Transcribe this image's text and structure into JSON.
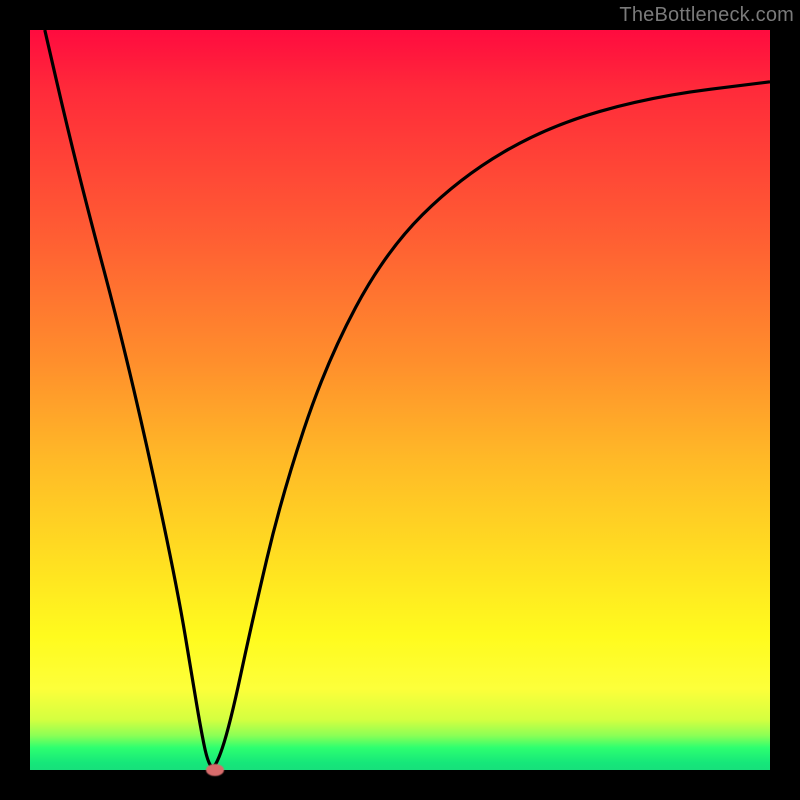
{
  "watermark": "TheBottleneck.com",
  "chart_data": {
    "type": "line",
    "title": "",
    "xlabel": "",
    "ylabel": "",
    "xlim": [
      0,
      100
    ],
    "ylim": [
      0,
      100
    ],
    "grid": false,
    "note": "Axes are unlabeled; values are normalized 0–100. Curve read from plotted line (approx).",
    "series": [
      {
        "name": "curve",
        "x": [
          2,
          5,
          8,
          12,
          16,
          20,
          22,
          23,
          24,
          25,
          27,
          30,
          34,
          40,
          48,
          58,
          70,
          84,
          100
        ],
        "y": [
          100,
          87,
          75,
          60,
          43,
          24,
          12,
          6,
          1,
          0,
          6,
          20,
          37,
          55,
          70,
          80,
          87,
          91,
          93
        ]
      }
    ],
    "marker": {
      "name": "minimum-point",
      "x": 25,
      "y": 0,
      "color": "#d86b6b"
    },
    "background_gradient": {
      "direction": "vertical",
      "stops": [
        {
          "pos": 0.0,
          "color": "#ff0b3f"
        },
        {
          "pos": 0.45,
          "color": "#ff8f2c"
        },
        {
          "pos": 0.8,
          "color": "#fffb1e"
        },
        {
          "pos": 0.97,
          "color": "#2dff70"
        },
        {
          "pos": 1.0,
          "color": "#17e07b"
        }
      ]
    }
  }
}
